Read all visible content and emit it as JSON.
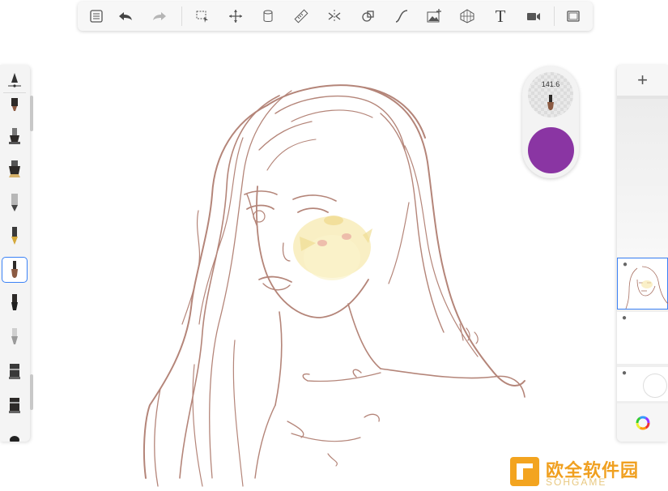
{
  "toolbar": {
    "tools": [
      {
        "name": "gallery-icon"
      },
      {
        "name": "undo-icon"
      },
      {
        "name": "redo-icon"
      },
      {
        "name": "selection-icon"
      },
      {
        "name": "transform-icon"
      },
      {
        "name": "fill-bucket-icon"
      },
      {
        "name": "ruler-icon"
      },
      {
        "name": "symmetry-icon"
      },
      {
        "name": "shapes-icon"
      },
      {
        "name": "curve-icon"
      },
      {
        "name": "import-image-icon"
      },
      {
        "name": "perspective-guide-icon"
      },
      {
        "name": "text-icon"
      },
      {
        "name": "record-video-icon"
      },
      {
        "name": "fullscreen-icon"
      }
    ],
    "text_tool_glyph": "T"
  },
  "brush_puck": {
    "size_value": "141.6",
    "current_color": "#8a35a3"
  },
  "layers": {
    "add_label": "+",
    "items": [
      {
        "name": "sketch-layer",
        "visible": true,
        "active": true
      },
      {
        "name": "empty-layer",
        "visible": true,
        "active": false
      },
      {
        "name": "background-layer",
        "visible": true,
        "active": false
      }
    ]
  },
  "watermark": {
    "text": "欧全软件园",
    "sub": "SOHGAME"
  },
  "colors": {
    "accent": "#3b82f6",
    "sketch_line": "#a86a5c"
  }
}
